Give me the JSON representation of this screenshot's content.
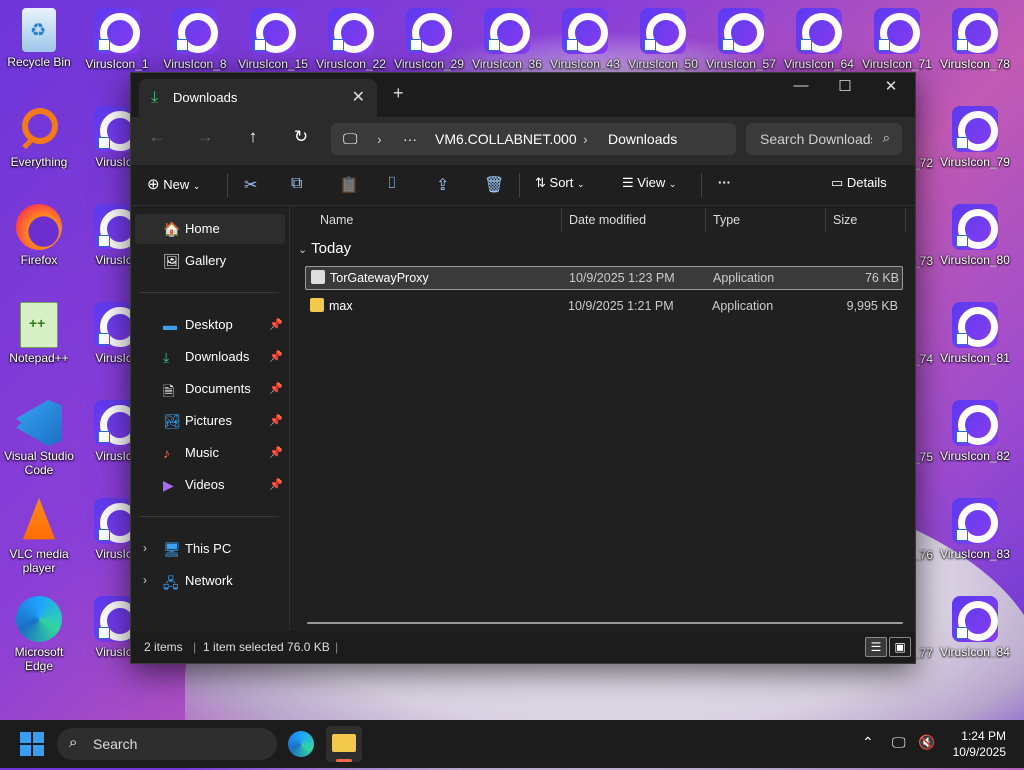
{
  "desktop": {
    "left_icons": [
      {
        "label": "Recycle Bin",
        "icon": "recycle-bin-icon"
      },
      {
        "label": "Everything",
        "icon": "everything-search-icon"
      },
      {
        "label": "Firefox",
        "icon": "firefox-icon"
      },
      {
        "label": "Notepad++",
        "icon": "notepadpp-icon"
      },
      {
        "label": "Visual Studio Code",
        "icon": "vscode-icon"
      },
      {
        "label": "VLC media player",
        "icon": "vlc-icon"
      },
      {
        "label": "Microsoft Edge",
        "icon": "edge-icon"
      }
    ],
    "top_row": [
      "VirusIcon_1",
      "VirusIcon_8",
      "VirusIcon_15",
      "VirusIcon_22",
      "VirusIcon_29",
      "VirusIcon_36",
      "VirusIcon_43",
      "VirusIcon_50",
      "VirusIcon_57",
      "VirusIcon_64",
      "VirusIcon_71",
      "VirusIcon_78"
    ],
    "col2": [
      "VirusIco",
      "VirusIco",
      "VirusIco",
      "VirusIco",
      "VirusIco",
      "VirusIco"
    ],
    "right_partial": [
      "_72",
      "_73",
      "_74",
      "_75",
      "_76",
      "_77"
    ],
    "right_col": [
      "VirusIcon_79",
      "VirusIcon_80",
      "VirusIcon_81",
      "VirusIcon_82",
      "VirusIcon_83",
      "VirusIcon_84"
    ]
  },
  "explorer": {
    "tab_title": "Downloads",
    "new_tab": "+",
    "window_controls": {
      "minimize": "—",
      "maximize": "☐",
      "close": "✕"
    },
    "nav": {
      "back": "←",
      "forward": "→",
      "up": "↑",
      "refresh": "↻"
    },
    "address": {
      "computer": "🖵",
      "ellipsis": "···",
      "segment1": "VM6.COLLABNET.000",
      "segment2": "Downloads",
      "chev": "›"
    },
    "search_placeholder": "Search Downloads",
    "command_bar": {
      "new": "New",
      "sort": "Sort",
      "view": "View",
      "more": "···",
      "details": "Details"
    },
    "sidebar": {
      "home": "Home",
      "gallery": "Gallery",
      "quick": [
        "Desktop",
        "Downloads",
        "Documents",
        "Pictures",
        "Music",
        "Videos"
      ],
      "this_pc": "This PC",
      "network": "Network"
    },
    "columns": {
      "name": "Name",
      "date": "Date modified",
      "type": "Type",
      "size": "Size"
    },
    "group": "Today",
    "files": [
      {
        "name": "TorGatewayProxy",
        "date": "10/9/2025 1:23 PM",
        "type": "Application",
        "size": "76 KB"
      },
      {
        "name": "max",
        "date": "10/9/2025 1:21 PM",
        "type": "Application",
        "size": "9,995 KB"
      }
    ],
    "status": {
      "count": "2 items",
      "selected": "1 item selected  76.0 KB"
    }
  },
  "taskbar": {
    "search_label": "Search",
    "time": "1:24 PM",
    "date": "10/9/2025"
  },
  "colors": {
    "accent": "#3a9df0",
    "window_bg": "#202020",
    "selection": "#3a3a3a"
  }
}
